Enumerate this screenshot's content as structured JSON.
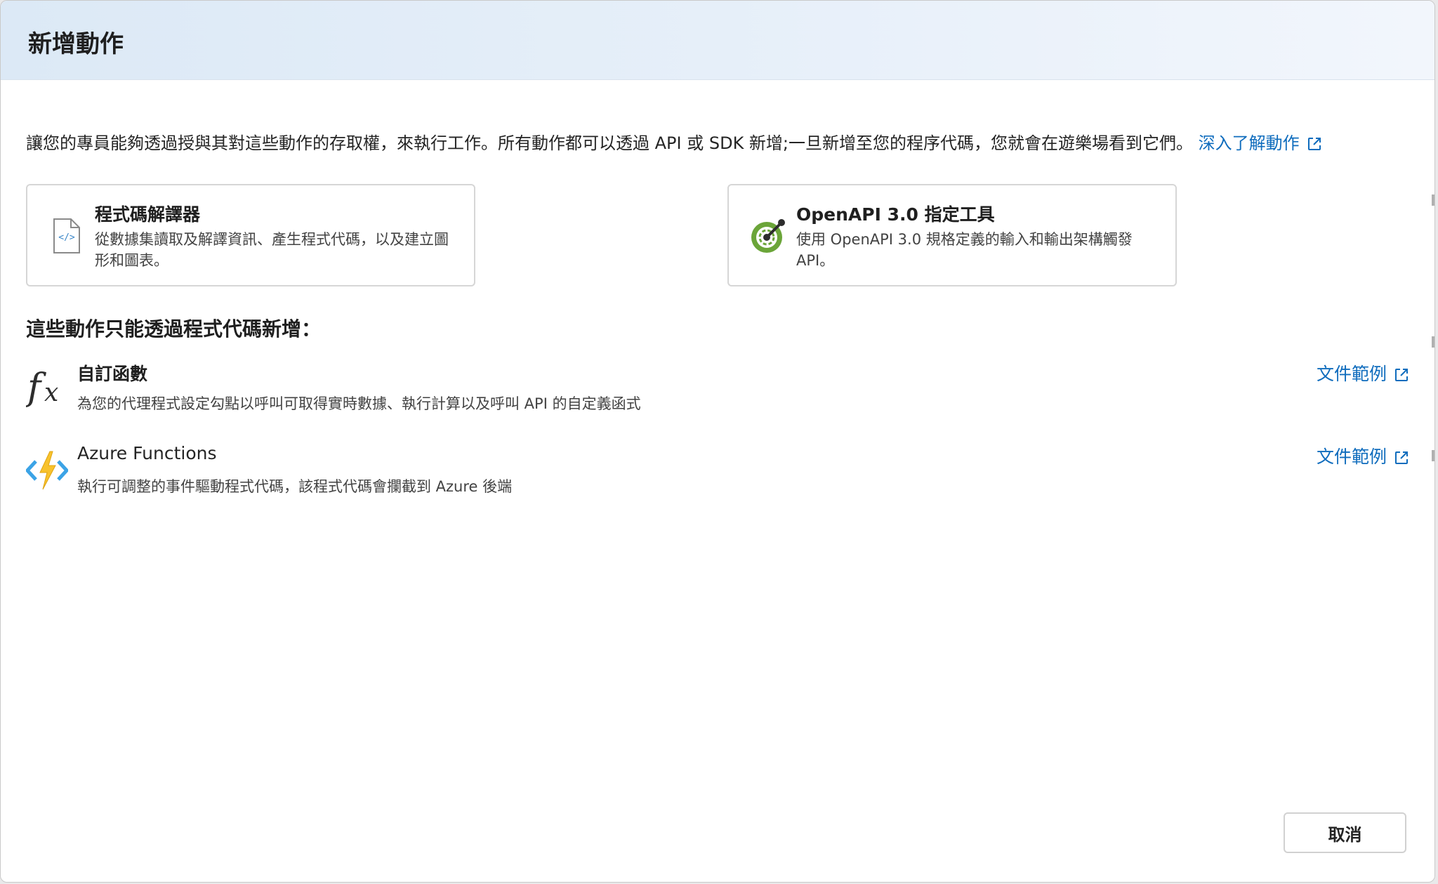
{
  "dialog": {
    "title": "新增動作",
    "intro_text": "讓您的專員能夠透過授與其對這些動作的存取權，來執行工作。所有動作都可以透過 API 或 SDK 新增;一旦新增至您的程序代碼，您就會在遊樂場看到它們。",
    "learn_more_label": "深入了解動作"
  },
  "cards": [
    {
      "title": "程式碼解譯器",
      "description": "從數據集讀取及解譯資訊、產生程式代碼，以及建立圖形和圖表。",
      "icon": "code-file-icon"
    },
    {
      "title": "OpenAPI 3.0 指定工具",
      "description": "使用 OpenAPI 3.0 規格定義的輸入和輸出架構觸發 API。",
      "icon": "openapi-icon"
    }
  ],
  "code_only_section": {
    "title": "這些動作只能透過程式代碼新增：",
    "items": [
      {
        "title": "自訂函數",
        "description": "為您的代理程式設定勾點以呼叫可取得實時數據、執行計算以及呼叫 API 的自定義函式",
        "link_label": "文件範例",
        "icon": "function-fx-icon"
      },
      {
        "title": "Azure Functions",
        "description": "執行可調整的事件驅動程式代碼，該程式代碼會攔截到 Azure 後端",
        "link_label": "文件範例",
        "icon": "azure-functions-icon"
      }
    ]
  },
  "footer": {
    "cancel_label": "取消"
  },
  "colors": {
    "link": "#0f6cbd",
    "header_gradient_start": "#dce9f6",
    "openapi_green": "#6ba539",
    "azure_yellow": "#f8c22c",
    "azure_blue": "#3ba3e6"
  }
}
